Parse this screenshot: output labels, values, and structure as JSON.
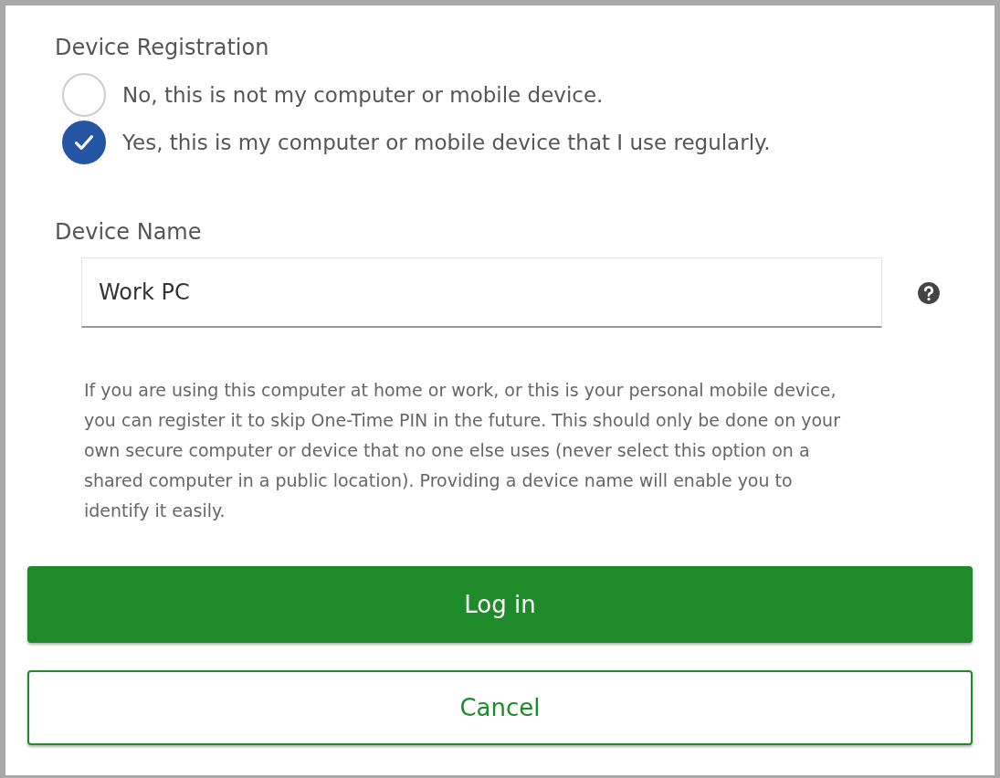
{
  "registration": {
    "heading": "Device Registration",
    "options": [
      {
        "label": "No, this is not my computer or mobile device.",
        "selected": false
      },
      {
        "label": "Yes, this is my computer or mobile device that I use regularly.",
        "selected": true
      }
    ]
  },
  "device_name": {
    "label": "Device Name",
    "value": "Work PC"
  },
  "help_text": "If you are using this computer at home or work, or this is your personal mobile device, you can register it to skip One-Time PIN in the future. This should only be done on your own secure computer or device that no one else uses (never select this option on a shared computer in a public location). Providing a device name will enable you to identify it easily.",
  "buttons": [
    {
      "label": "Log in",
      "kind": "primary"
    },
    {
      "label": "Cancel",
      "kind": "secondary"
    }
  ]
}
